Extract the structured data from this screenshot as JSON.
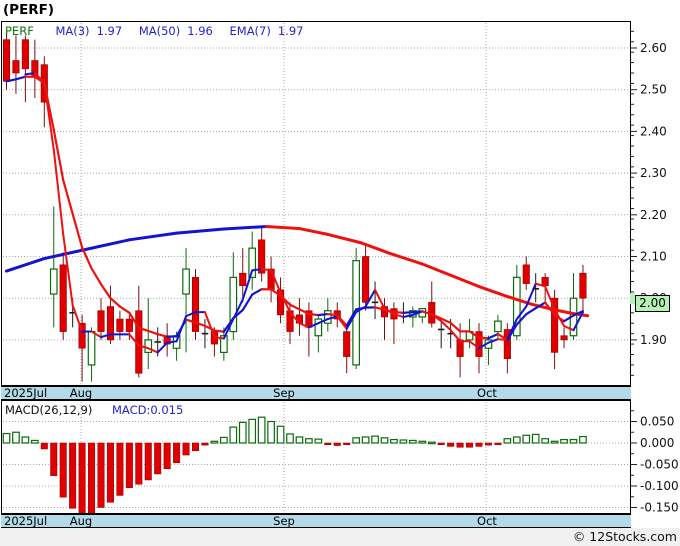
{
  "header": {
    "title": "(PERF)"
  },
  "main_chart": {
    "legend": {
      "symbol": "PERF",
      "items": [
        {
          "label": "MA(3)",
          "value": "1.97"
        },
        {
          "label": "MA(50)",
          "value": "1.96"
        },
        {
          "label": "EMA(7)",
          "value": "1.97"
        }
      ]
    },
    "last_price": "2.00"
  },
  "macd": {
    "legend_label": "MACD(26,12,9)",
    "legend_value": "MACD:0.015"
  },
  "months": [
    {
      "label": "2025Jul"
    },
    {
      "label": "Aug"
    },
    {
      "label": "Sep"
    },
    {
      "label": "Oct"
    }
  ],
  "footer": {
    "copyright": "© 12Stocks.com"
  },
  "colors": {
    "candle_up": "#0a6b0a",
    "candle_down": "#e10000",
    "candle_down_border": "#8d0000",
    "wick_down": "#7a1010",
    "doji": "#1a1a1a",
    "ma_up": "#1414cf",
    "ma_down": "#ee1111",
    "grid": "#a8a8a8",
    "axis_text": "#111111",
    "datebar_bg": "#b3dae8",
    "price_box_bg": "#b5f2b5",
    "macd_up": "#0a6b0a",
    "macd_down": "#e10000"
  },
  "chart_data": {
    "type": "candlestick_with_macd",
    "symbol": "PERF",
    "title": "(PERF)",
    "price_axis": {
      "labels": [
        {
          "text": "2.60",
          "value": 2.6
        },
        {
          "text": "2.50",
          "value": 2.5
        },
        {
          "text": "2.40",
          "value": 2.4
        },
        {
          "text": "2.30",
          "value": 2.3
        },
        {
          "text": "2.20",
          "value": 2.2
        },
        {
          "text": "2.10",
          "value": 2.1
        },
        {
          "text": "2.00",
          "value": 2.0
        },
        {
          "text": "1.90",
          "value": 1.9
        }
      ],
      "minor_step": 0.025,
      "range": [
        1.79,
        2.66
      ]
    },
    "macd_axis": {
      "labels": [
        {
          "text": "0.050",
          "value": 0.05
        },
        {
          "text": "0.000",
          "value": 0.0
        },
        {
          "text": "-0.050",
          "value": -0.05
        },
        {
          "text": "-0.100",
          "value": -0.1
        },
        {
          "text": "-0.150",
          "value": -0.15
        }
      ],
      "minor_step": 0.025,
      "range": [
        -0.166,
        0.094
      ]
    },
    "candles_note": "each candle = [open, high, low, close, optional 1 = black doji]",
    "candles": [
      [
        2.62,
        2.64,
        2.5,
        2.52
      ],
      [
        2.57,
        2.63,
        2.49,
        2.54
      ],
      [
        2.62,
        2.63,
        2.47,
        2.55
      ],
      [
        2.57,
        2.62,
        2.48,
        2.53
      ],
      [
        2.56,
        2.58,
        2.41,
        2.47
      ],
      [
        2.01,
        2.22,
        1.93,
        2.07
      ],
      [
        2.08,
        2.11,
        1.9,
        1.92
      ],
      [
        1.97,
        2.0,
        1.93,
        1.96,
        1
      ],
      [
        1.94,
        1.96,
        1.8,
        1.88
      ],
      [
        1.84,
        1.93,
        1.8,
        1.92
      ],
      [
        1.97,
        2.0,
        1.9,
        1.92
      ],
      [
        1.98,
        2.03,
        1.89,
        1.9
      ],
      [
        1.95,
        1.97,
        1.9,
        1.92
      ],
      [
        1.95,
        1.96,
        1.9,
        1.92
      ],
      [
        1.97,
        2.03,
        1.81,
        1.82
      ],
      [
        1.87,
        2.0,
        1.83,
        1.9
      ],
      [
        1.9,
        1.93,
        1.86,
        1.89,
        1
      ],
      [
        1.91,
        1.94,
        1.86,
        1.89
      ],
      [
        1.88,
        1.92,
        1.85,
        1.91
      ],
      [
        2.01,
        2.12,
        1.87,
        2.07
      ],
      [
        2.05,
        2.07,
        1.9,
        1.92
      ],
      [
        1.92,
        1.95,
        1.88,
        1.91,
        1
      ],
      [
        1.92,
        1.93,
        1.86,
        1.89
      ],
      [
        1.87,
        1.93,
        1.85,
        1.91
      ],
      [
        1.92,
        2.11,
        1.9,
        2.05
      ],
      [
        2.06,
        2.12,
        1.99,
        2.03
      ],
      [
        2.05,
        2.16,
        2.02,
        2.12
      ],
      [
        2.14,
        2.17,
        2.04,
        2.06
      ],
      [
        2.07,
        2.1,
        1.99,
        2.02
      ],
      [
        2.02,
        2.05,
        1.94,
        1.96
      ],
      [
        1.97,
        1.99,
        1.89,
        1.92
      ],
      [
        1.96,
        2.0,
        1.91,
        1.94
      ],
      [
        1.97,
        1.99,
        1.86,
        1.93
      ],
      [
        1.91,
        1.96,
        1.87,
        1.95
      ],
      [
        1.94,
        2.0,
        1.92,
        1.97
      ],
      [
        1.97,
        1.99,
        1.93,
        1.95
      ],
      [
        1.92,
        1.93,
        1.82,
        1.86
      ],
      [
        1.84,
        2.12,
        1.83,
        2.09
      ],
      [
        2.1,
        2.13,
        1.97,
        1.99
      ],
      [
        2.0,
        2.04,
        1.95,
        1.98,
        1
      ],
      [
        1.98,
        2.0,
        1.9,
        1.955
      ],
      [
        1.975,
        1.99,
        1.89,
        1.95
      ],
      [
        1.97,
        1.99,
        1.94,
        1.96,
        1
      ],
      [
        1.955,
        1.98,
        1.93,
        1.97
      ],
      [
        1.955,
        1.975,
        1.94,
        1.975
      ],
      [
        1.99,
        2.04,
        1.93,
        1.94
      ],
      [
        1.93,
        1.95,
        1.88,
        1.92,
        1
      ],
      [
        1.92,
        1.95,
        1.88,
        1.91,
        1
      ],
      [
        1.9,
        1.94,
        1.81,
        1.86
      ],
      [
        1.9,
        1.95,
        1.88,
        1.92
      ],
      [
        1.92,
        1.94,
        1.82,
        1.86
      ],
      [
        1.88,
        1.91,
        1.84,
        1.9
      ],
      [
        1.92,
        1.96,
        1.9,
        1.945
      ],
      [
        1.925,
        1.94,
        1.82,
        1.855
      ],
      [
        1.91,
        2.08,
        1.9,
        2.05
      ],
      [
        2.08,
        2.1,
        2.02,
        2.035
      ],
      [
        2.025,
        2.06,
        1.99,
        2.02,
        1
      ],
      [
        2.05,
        2.06,
        1.99,
        2.03
      ],
      [
        2.0,
        2.02,
        1.83,
        1.87
      ],
      [
        1.91,
        1.93,
        1.88,
        1.9
      ],
      [
        1.91,
        2.06,
        1.9,
        2.0
      ],
      [
        2.06,
        2.08,
        1.97,
        2.0
      ]
    ],
    "macd_hist": [
      0.022,
      0.025,
      0.014,
      0.006,
      -0.014,
      -0.076,
      -0.126,
      -0.152,
      -0.168,
      -0.164,
      -0.15,
      -0.138,
      -0.122,
      -0.104,
      -0.096,
      -0.086,
      -0.072,
      -0.06,
      -0.046,
      -0.028,
      -0.018,
      -0.005,
      0.004,
      0.013,
      0.037,
      0.048,
      0.055,
      0.06,
      0.05,
      0.039,
      0.021,
      0.014,
      0.01,
      0.009,
      -0.004,
      -0.006,
      -0.004,
      0.012,
      0.014,
      0.016,
      0.012,
      0.008,
      0.007,
      0.006,
      0.004,
      0.002,
      -0.004,
      -0.008,
      -0.01,
      -0.01,
      -0.008,
      -0.005,
      -0.004,
      0.01,
      0.014,
      0.018,
      0.02,
      0.01,
      0.004,
      0.008,
      0.008,
      0.015
    ],
    "ma50_note": "pairs of [bar-index, price], colored blue while rising, red while falling",
    "ma50": [
      [
        0,
        2.065
      ],
      [
        4,
        2.095
      ],
      [
        8,
        2.115
      ],
      [
        13,
        2.14
      ],
      [
        18,
        2.156
      ],
      [
        23,
        2.166
      ],
      [
        27.5,
        2.172
      ],
      [
        31,
        2.167
      ],
      [
        34,
        2.153
      ],
      [
        37.5,
        2.133
      ],
      [
        40.5,
        2.108
      ],
      [
        44,
        2.082
      ],
      [
        47,
        2.055
      ],
      [
        50,
        2.028
      ],
      [
        53,
        2.004
      ],
      [
        55.5,
        1.986
      ],
      [
        58,
        1.972
      ],
      [
        60,
        1.963
      ],
      [
        61.5,
        1.958
      ]
    ],
    "ma3_period": 3,
    "ema7_period": 7,
    "legend_position": "top-left",
    "grid": true
  }
}
